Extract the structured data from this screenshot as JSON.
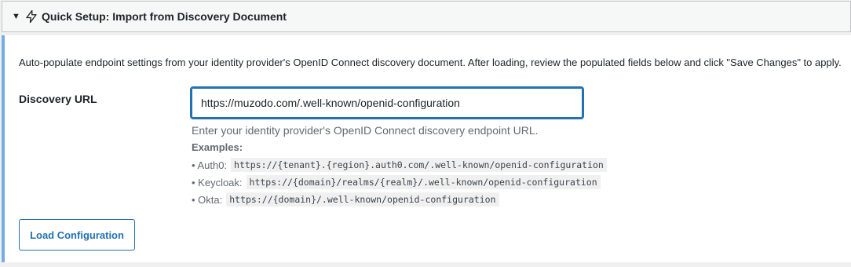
{
  "section": {
    "toggle_icon": "triangle-down-icon",
    "icon": "lightning-bolt-icon",
    "title": "Quick Setup: Import from Discovery Document",
    "accent_color": "#72aee6"
  },
  "intro": "Auto-populate endpoint settings from your identity provider's OpenID Connect discovery document. After loading, review the populated fields below and click \"Save Changes\" to apply.",
  "discovery": {
    "label": "Discovery URL",
    "value": "https://muzodo.com/.well-known/openid-configuration",
    "description": "Enter your identity provider's OpenID Connect discovery endpoint URL.",
    "examples_title": "Examples:",
    "examples": [
      {
        "provider": "• Auth0:",
        "url": "https://{tenant}.{region}.auth0.com/.well-known/openid-configuration"
      },
      {
        "provider": "• Keycloak:",
        "url": "https://{domain}/realms/{realm}/.well-known/openid-configuration"
      },
      {
        "provider": "• Okta:",
        "url": "https://{domain}/.well-known/openid-configuration"
      }
    ]
  },
  "load_button": "Load Configuration",
  "colors": {
    "primary": "#2271b1",
    "muted_text": "#646970"
  }
}
